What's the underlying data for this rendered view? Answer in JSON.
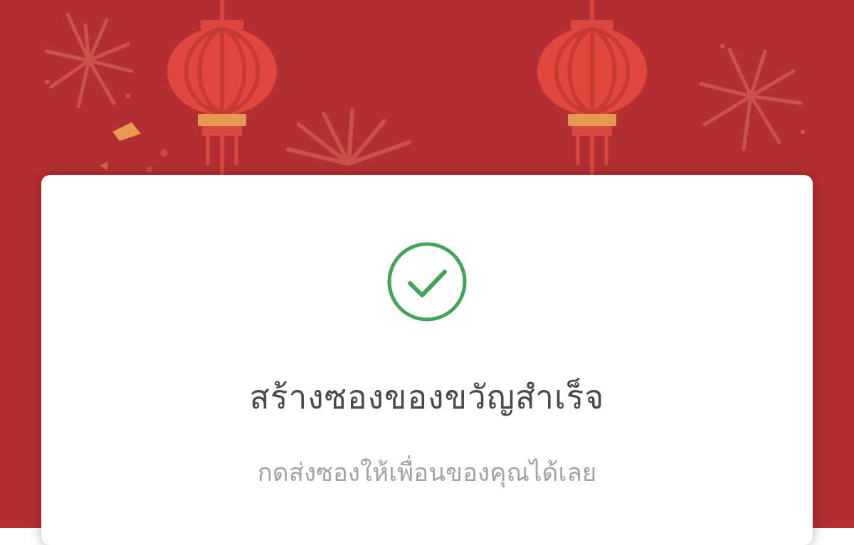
{
  "banner": {
    "background_color": "#b32f33",
    "decorations": [
      "lantern-icon",
      "lantern-icon",
      "firework-icon",
      "firework-icon",
      "firework-icon",
      "confetti-icon"
    ]
  },
  "card": {
    "status_icon": "check-circle-icon",
    "status_color": "#43a35a",
    "title": "สร้างซองของขวัญสำเร็จ",
    "subtitle": "กดส่งซองให้เพื่อนของคุณได้เลย"
  }
}
